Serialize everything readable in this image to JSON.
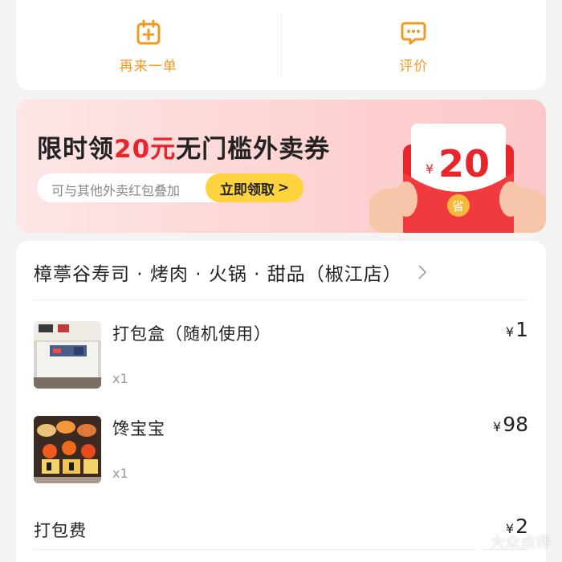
{
  "actions": {
    "reorder": {
      "label": "再来一单",
      "icon": "calendar-plus-icon"
    },
    "review": {
      "label": "评价",
      "icon": "chat-bubble-icon"
    }
  },
  "banner": {
    "title_prefix": "限时领",
    "title_amount": "20元",
    "title_suffix": "无门槛外卖券",
    "subtitle": "可与其他外卖红包叠加",
    "cta_label": "立即领取",
    "cta_arrow": ">",
    "envelope_value": "20",
    "envelope_currency": "¥",
    "envelope_seal": "省"
  },
  "order": {
    "shop_name": "樟葶谷寿司 · 烤肉 · 火锅 · 甜品（椒江店）",
    "items": [
      {
        "name": "打包盒（随机使用）",
        "qty": "x1",
        "currency": "¥",
        "price": "1"
      },
      {
        "name": "馋宝宝",
        "qty": "x1",
        "currency": "¥",
        "price": "98"
      }
    ],
    "packing_fee": {
      "label": "打包费",
      "currency": "¥",
      "amount": "2"
    }
  },
  "watermark": "大众点评",
  "colors": {
    "accent_orange": "#f19a22",
    "promo_red": "#e8252a",
    "cta_yellow": "#ffd33d"
  }
}
